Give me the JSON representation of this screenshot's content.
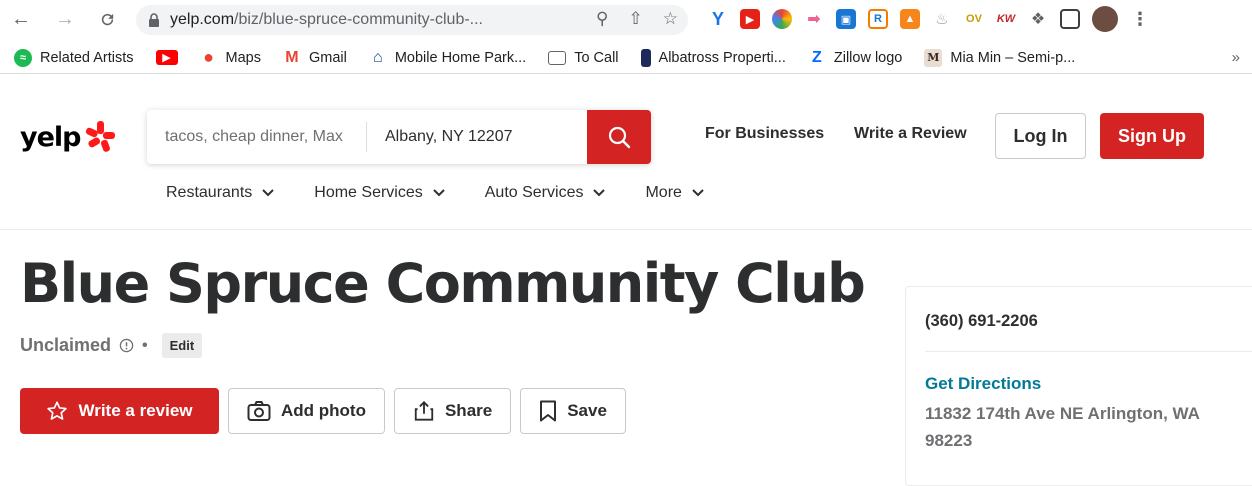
{
  "browser": {
    "url_host": "yelp.com",
    "url_path": "/biz/blue-spruce-community-club-...",
    "bookmarks": [
      {
        "label": "Related Artists",
        "icon": "spotify-icon",
        "color": "#1db954"
      },
      {
        "label": "",
        "icon": "youtube-icon",
        "color": "#ff0000"
      },
      {
        "label": "Maps",
        "icon": "maps-pin-icon",
        "color": "#34a853"
      },
      {
        "label": "Gmail",
        "icon": "gmail-icon",
        "color": "#ea4335"
      },
      {
        "label": "Mobile Home Park...",
        "icon": "house-icon",
        "color": "#1a4b8c"
      },
      {
        "label": "To Call",
        "icon": "folder-icon",
        "color": "#5f6368"
      },
      {
        "label": "Albatross Properti...",
        "icon": "building-icon",
        "color": "#1d2a5a"
      },
      {
        "label": "Zillow logo",
        "icon": "zillow-icon",
        "color": "#006aff"
      },
      {
        "label": "Mia Min – Semi-p...",
        "icon": "medium-icon",
        "color": "#8b5e3c"
      }
    ],
    "bookmarks_more": "»"
  },
  "header": {
    "logo": "yelp",
    "search_find_placeholder": "tacos, cheap dinner, Max",
    "search_near_value": "Albany, NY 12207",
    "for_businesses": "For Businesses",
    "write_review": "Write a Review",
    "login": "Log In",
    "signup": "Sign Up",
    "categories": [
      "Restaurants",
      "Home Services",
      "Auto Services",
      "More"
    ]
  },
  "business": {
    "name": "Blue Spruce Community Club",
    "claim_status": "Unclaimed",
    "separator": "•",
    "edit_label": "Edit",
    "actions": {
      "write_review": "Write a review",
      "add_photo": "Add photo",
      "share": "Share",
      "save": "Save"
    }
  },
  "sidebar": {
    "phone": "(360) 691-2206",
    "directions_label": "Get Directions",
    "address": "11832 174th Ave NE Arlington, WA 98223"
  },
  "colors": {
    "brand_red": "#d32323",
    "link_teal": "#027a97"
  }
}
